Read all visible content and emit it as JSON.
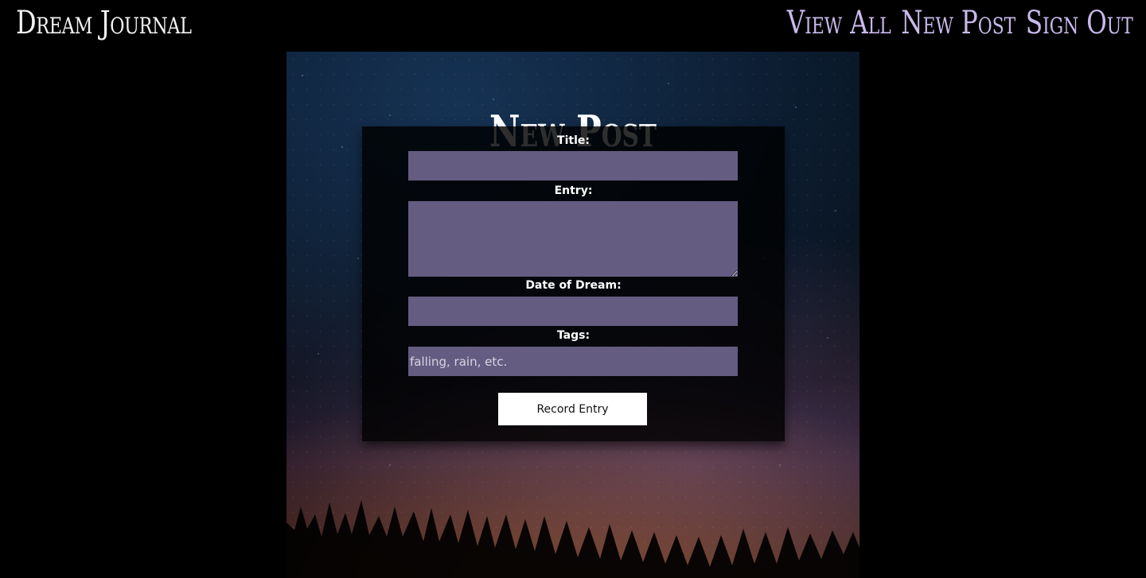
{
  "header": {
    "brand": "Dream Journal",
    "nav": [
      {
        "label": "View All"
      },
      {
        "label": "New Post"
      },
      {
        "label": "Sign Out"
      }
    ]
  },
  "main": {
    "title": "New Post",
    "form": {
      "title_label": "Title:",
      "entry_label": "Entry:",
      "date_label": "Date of Dream:",
      "tags_label": "Tags:",
      "tags_placeholder": "falling, rain, etc.",
      "submit_label": "Record Entry"
    }
  }
}
